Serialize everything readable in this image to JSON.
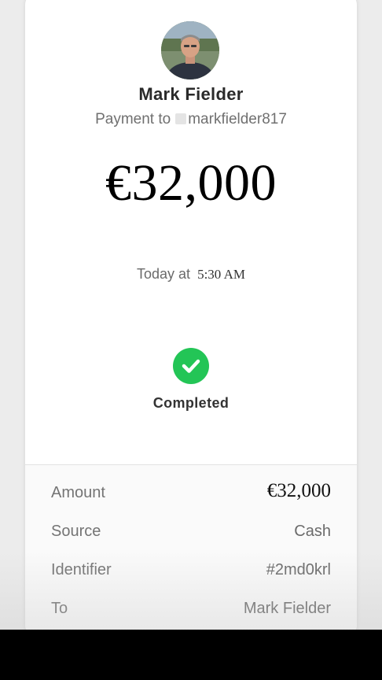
{
  "recipient": {
    "name": "Mark Fielder",
    "payment_prefix": "Payment to",
    "handle": "markfielder817"
  },
  "payment": {
    "amount": "€32,000",
    "date_prefix": "Today at",
    "time": "5:30 AM",
    "status": "Completed",
    "status_color": "#23c556"
  },
  "details": [
    {
      "label": "Amount",
      "value": "€32,000"
    },
    {
      "label": "Source",
      "value": "Cash"
    },
    {
      "label": "Identifier",
      "value": "#2md0krl"
    },
    {
      "label": "To",
      "value": "Mark Fielder"
    }
  ],
  "icons": {
    "avatar": "profile-photo",
    "status": "checkmark-icon"
  }
}
